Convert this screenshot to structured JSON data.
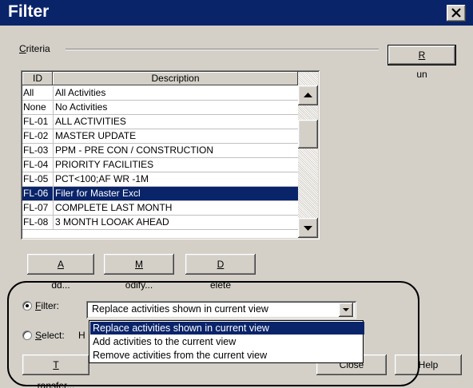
{
  "window": {
    "title": "Filter",
    "close_glyph": "×"
  },
  "criteria": {
    "label_u": "C",
    "label_rest": "riteria"
  },
  "buttons": {
    "run": {
      "u": "R",
      "rest": "un"
    },
    "add": {
      "u": "A",
      "rest": "dd..."
    },
    "modify": {
      "u": "M",
      "rest": "odify..."
    },
    "delete": {
      "u": "D",
      "rest": "elete"
    },
    "transfer": {
      "u": "T",
      "rest": "ransfer..."
    },
    "close": "Close",
    "help": "Help"
  },
  "table": {
    "columns": [
      "ID",
      "Description"
    ],
    "rows": [
      {
        "id": "All",
        "desc": "All Activities"
      },
      {
        "id": "None",
        "desc": "No Activities"
      },
      {
        "id": "FL-01",
        "desc": "ALL ACTIVITIES"
      },
      {
        "id": "FL-02",
        "desc": "MASTER UPDATE"
      },
      {
        "id": "FL-03",
        "desc": "PPM - PRE CON / CONSTRUCTION"
      },
      {
        "id": "FL-04",
        "desc": "PRIORITY FACILITIES"
      },
      {
        "id": "FL-05",
        "desc": "PCT<100;AF WR -1M"
      },
      {
        "id": "FL-06",
        "desc": "Filer for Master Excl"
      },
      {
        "id": "FL-07",
        "desc": "COMPLETE LAST MONTH"
      },
      {
        "id": "FL-08",
        "desc": "3 MONTH LOOAK AHEAD"
      }
    ],
    "selected_index": 7
  },
  "options": {
    "filter": {
      "u": "F",
      "rest": "ilter:",
      "checked": true
    },
    "select": {
      "u": "S",
      "rest": "elect:",
      "checked": false,
      "trailing": "H"
    }
  },
  "combo": {
    "value": "Replace activities shown in current view",
    "options": [
      "Replace activities shown in current view",
      "Add activities to the current view",
      "Remove activities from the current view"
    ],
    "selected_index": 0
  },
  "colors": {
    "selection": "#0a246a",
    "face": "#d4d0c8",
    "title_bar": "#0a246a"
  }
}
